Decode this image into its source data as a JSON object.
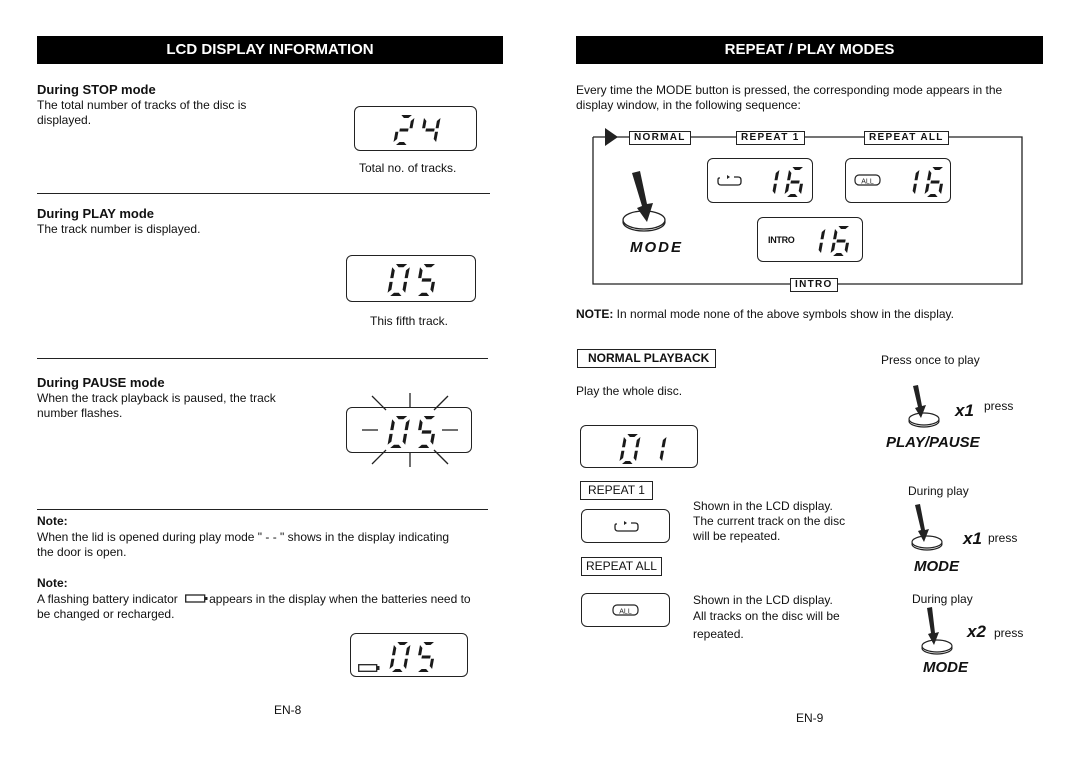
{
  "left_page": {
    "banner": "LCD DISPLAY INFORMATION",
    "stop": {
      "heading": "During STOP mode",
      "text_line1": "The total number of tracks of the disc is",
      "text_line2": "displayed.",
      "lcd_digits": "24",
      "caption": "Total no. of tracks."
    },
    "play": {
      "heading": "During PLAY mode",
      "text": "The track number is displayed.",
      "lcd_digits": "05",
      "caption": "This fifth track."
    },
    "pause": {
      "heading": "During PAUSE mode",
      "text_line1": "When the track playback is paused, the track",
      "text_line2": "number flashes.",
      "lcd_digits": "05"
    },
    "note1": {
      "label": "Note:",
      "text_line1": "When the lid is opened during play mode \" - - \" shows in the display indicating",
      "text_line2": "the door is open."
    },
    "note2": {
      "label": "Note:",
      "text_before": "A flashing battery indicator",
      "text_after": "appears in the display when the batteries need to",
      "text_line2": "be changed or recharged.",
      "lcd_digits": "05",
      "icon": "battery-icon"
    },
    "page_number": "EN-8"
  },
  "right_page": {
    "banner": "REPEAT / PLAY MODES",
    "intro_line1": "Every time the MODE button is pressed, the corresponding mode appears in the",
    "intro_line2": "display window, in the following sequence:",
    "sequence": {
      "labels": [
        "NORMAL",
        "REPEAT 1",
        "REPEAT ALL",
        "INTRO"
      ],
      "mode_button_label": "MODE",
      "repeat1_lcd_digits": "16",
      "repeatall_lcd_digits": "16",
      "intro_lcd_digits": "16",
      "intro_lcd_tag": "INTRO",
      "all_badge": "ALL"
    },
    "note": {
      "label": "NOTE:",
      "text": " In normal mode none of the above symbols show in the display."
    },
    "normal_playback": {
      "label": "NORMAL PLAYBACK",
      "text": "Play the whole disc.",
      "lcd_digits": "01",
      "instruction": "Press once to play",
      "count": "x1",
      "press": "press",
      "button_label": "PLAY/PAUSE"
    },
    "repeat1": {
      "label": "REPEAT 1",
      "line1": "Shown in the LCD display.",
      "line2": "The current track on the disc",
      "line3": "will be repeated.",
      "instruction": "During play",
      "count": "x1",
      "press": "press",
      "button_label": "MODE"
    },
    "repeatall": {
      "label": "REPEAT ALL",
      "line1": "Shown in the LCD display.",
      "line2": "All tracks on the disc will be",
      "line3": "repeated.",
      "instruction": "During play",
      "count": "x2",
      "press": "press",
      "button_label": "MODE",
      "all_badge": "ALL"
    },
    "page_number": "EN-9"
  }
}
